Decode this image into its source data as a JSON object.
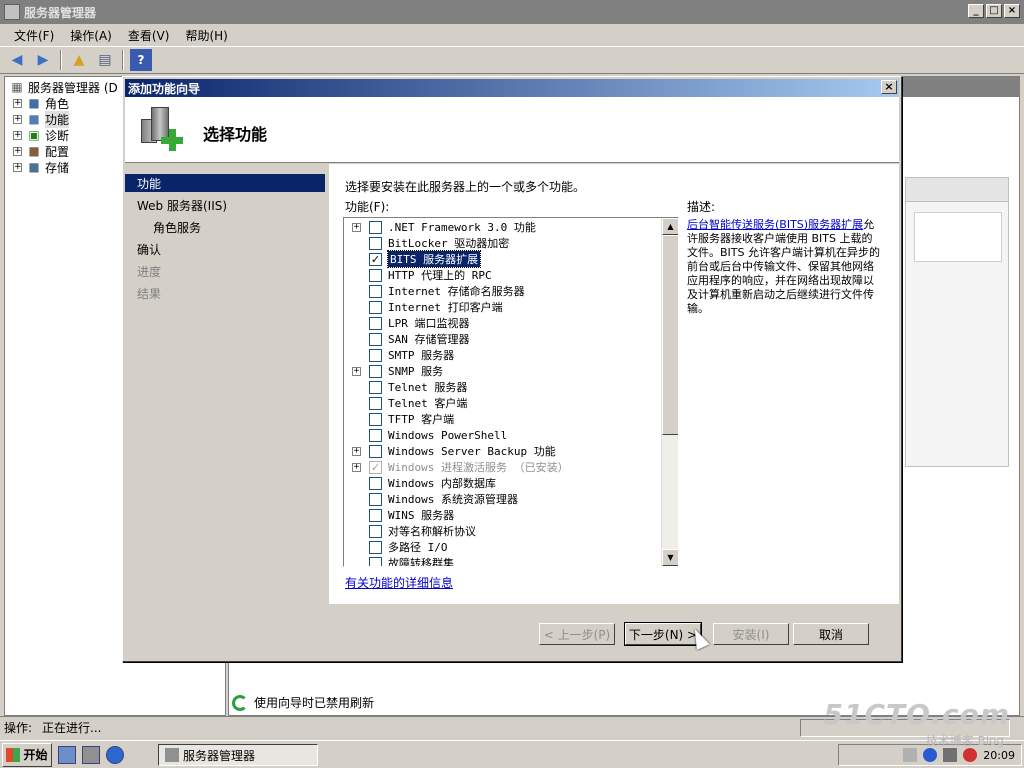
{
  "window": {
    "title": "服务器管理器",
    "controls": [
      "_",
      "□",
      "×"
    ]
  },
  "menu": [
    "文件(F)",
    "操作(A)",
    "查看(V)",
    "帮助(H)"
  ],
  "tree": {
    "root": "服务器管理器 (D",
    "items": [
      "角色",
      "功能",
      "诊断",
      "配置",
      "存储"
    ]
  },
  "refresh_message": "使用向导时已禁用刷新",
  "status": {
    "label": "操作:",
    "text": "正在进行..."
  },
  "taskbar": {
    "start": "开始",
    "task": "服务器管理器",
    "clock": "20:09"
  },
  "watermark": {
    "main": "51CTO.com",
    "sub": "技术博客 Blog"
  },
  "dialog": {
    "title": "添加功能向导",
    "close": "×",
    "heading": "选择功能",
    "nav": [
      {
        "label": "功能",
        "state": "active"
      },
      {
        "label": "Web 服务器(IIS)",
        "state": "normal"
      },
      {
        "label": "角色服务",
        "state": "sub"
      },
      {
        "label": "确认",
        "state": "normal"
      },
      {
        "label": "进度",
        "state": "disabled"
      },
      {
        "label": "结果",
        "state": "disabled"
      }
    ],
    "instruction": "选择要安装在此服务器上的一个或多个功能。",
    "features_label": "功能(F):",
    "description_label": "描述:",
    "features": [
      {
        "label": ".NET Framework 3.0 功能",
        "expandable": true,
        "checked": false
      },
      {
        "label": "BitLocker 驱动器加密",
        "expandable": false,
        "checked": false
      },
      {
        "label": "BITS 服务器扩展",
        "expandable": false,
        "checked": true,
        "selected": true
      },
      {
        "label": "HTTP 代理上的 RPC",
        "expandable": false,
        "checked": false
      },
      {
        "label": "Internet 存储命名服务器",
        "expandable": false,
        "checked": false
      },
      {
        "label": "Internet 打印客户端",
        "expandable": false,
        "checked": false
      },
      {
        "label": "LPR 端口监视器",
        "expandable": false,
        "checked": false
      },
      {
        "label": "SAN 存储管理器",
        "expandable": false,
        "checked": false
      },
      {
        "label": "SMTP 服务器",
        "expandable": false,
        "checked": false
      },
      {
        "label": "SNMP 服务",
        "expandable": true,
        "checked": false
      },
      {
        "label": "Telnet 服务器",
        "expandable": false,
        "checked": false
      },
      {
        "label": "Telnet 客户端",
        "expandable": false,
        "checked": false
      },
      {
        "label": "TFTP 客户端",
        "expandable": false,
        "checked": false
      },
      {
        "label": "Windows PowerShell",
        "expandable": false,
        "checked": false
      },
      {
        "label": "Windows Server Backup 功能",
        "expandable": true,
        "checked": false
      },
      {
        "label": "Windows 进程激活服务  （已安装）",
        "expandable": true,
        "checked": true,
        "disabled": true
      },
      {
        "label": "Windows 内部数据库",
        "expandable": false,
        "checked": false
      },
      {
        "label": "Windows 系统资源管理器",
        "expandable": false,
        "checked": false
      },
      {
        "label": "WINS 服务器",
        "expandable": false,
        "checked": false
      },
      {
        "label": "对等名称解析协议",
        "expandable": false,
        "checked": false
      },
      {
        "label": "多路径 I/O",
        "expandable": false,
        "checked": false
      },
      {
        "label": "故障转移群集",
        "expandable": false,
        "checked": false
      }
    ],
    "description_link": "后台智能传送服务(BITS)服务器扩展",
    "description_text": "允许服务器接收客户端使用 BITS 上载的文件。BITS 允许客户端计算机在异步的前台或后台中传输文件、保留其他网络应用程序的响应，并在网络出现故障以及计算机重新启动之后继续进行文件传输。",
    "more_info_link": "有关功能的详细信息",
    "buttons": {
      "prev": "< 上一步(P)",
      "next": "下一步(N) >",
      "install": "安装(I)",
      "cancel": "取消"
    }
  }
}
